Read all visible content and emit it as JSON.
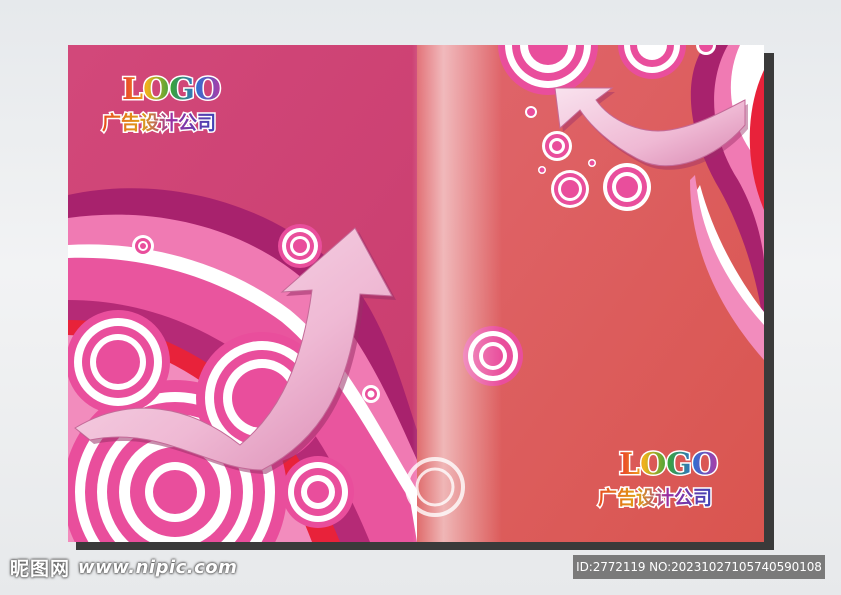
{
  "cover": {
    "back": {
      "logo": "LOGO",
      "company": "广告设计公司"
    },
    "front": {
      "logo": "LOGO",
      "company": "广告设计公司"
    }
  },
  "watermark": {
    "brand": "昵图网",
    "url": "www.nipic.com",
    "id_text": "ID:2772119 NO:20231027105740590108"
  },
  "colors": {
    "back_panel": "#d4507d",
    "front_panel": "#de6660",
    "pink_ring": "#e94e9c",
    "magenta_band": "#a8226d",
    "arrow": "#f2c6dc",
    "red_ribbon": "#e8223a"
  },
  "icons": [
    "arrow-up-icon",
    "ring-icon"
  ]
}
